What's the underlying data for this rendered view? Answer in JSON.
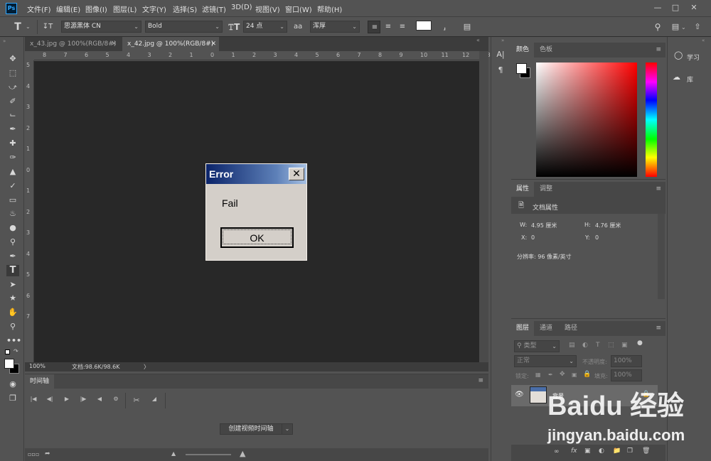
{
  "app": {
    "logo": "Ps"
  },
  "menu": [
    "文件(F)",
    "编辑(E)",
    "图像(I)",
    "图层(L)",
    "文字(Y)",
    "选择(S)",
    "滤镜(T)",
    "3D(D)",
    "视图(V)",
    "窗口(W)",
    "帮助(H)"
  ],
  "window_controls": [
    "minimize-icon",
    "maximize-icon",
    "close-icon"
  ],
  "options": {
    "tool_icon": "T",
    "font_family": "思源黑体 CN",
    "font_style": "Bold",
    "font_size": "24 点",
    "aa_label": "aa",
    "anti_alias": "浑厚",
    "color_swatch": "#ffffff"
  },
  "tabs": [
    {
      "label": "x_43.jpg @ 100%(RGB/8#)",
      "active": false
    },
    {
      "label": "x_42.jpg @ 100%(RGB/8#)",
      "active": true
    }
  ],
  "ruler": {
    "h": [
      "8",
      "7",
      "6",
      "5",
      "4",
      "3",
      "2",
      "1",
      "0",
      "1",
      "2",
      "3",
      "4",
      "5",
      "6",
      "7",
      "8",
      "9",
      "10",
      "11",
      "12",
      "13"
    ],
    "v": [
      "5",
      "4",
      "3",
      "2",
      "1",
      "0",
      "1",
      "2",
      "3",
      "4",
      "5",
      "6",
      "7"
    ]
  },
  "status": {
    "zoom": "100%",
    "doc": "文档:98.6K/98.6K",
    "arrow": "〉"
  },
  "dialog": {
    "title": "Error",
    "close": "✕",
    "message": "Fail",
    "ok": "OK"
  },
  "timeline": {
    "tab": "时间轴",
    "create": "创建视频时间轴"
  },
  "color_panel": {
    "tabs": [
      "颜色",
      "色板"
    ],
    "fg": "#ffffff",
    "bg": "#000000",
    "hue": "#ff0000"
  },
  "properties_panel": {
    "tabs": [
      "属性",
      "调整"
    ],
    "title": "文档属性",
    "w_label": "W:",
    "w_value": "4.95 厘米",
    "h_label": "H:",
    "h_value": "4.76 厘米",
    "x_label": "X:",
    "x_value": "0",
    "y_label": "Y:",
    "y_value": "0",
    "resolution": "分辨率: 96 像素/英寸"
  },
  "layers_panel": {
    "tabs": [
      "图层",
      "通道",
      "路径"
    ],
    "filter_type": "类型",
    "blend_mode": "正常",
    "opacity_label": "不透明度:",
    "opacity": "100%",
    "lock_label": "锁定:",
    "fill_label": "填充:",
    "fill": "100%",
    "layer_name": "背景"
  },
  "right_dock": [
    {
      "icon": "lightbulb-icon",
      "label": "学习"
    },
    {
      "icon": "library-icon",
      "label": "库"
    }
  ],
  "watermark": {
    "brand": "Baidu 经验",
    "url": "jingyan.baidu.com"
  }
}
